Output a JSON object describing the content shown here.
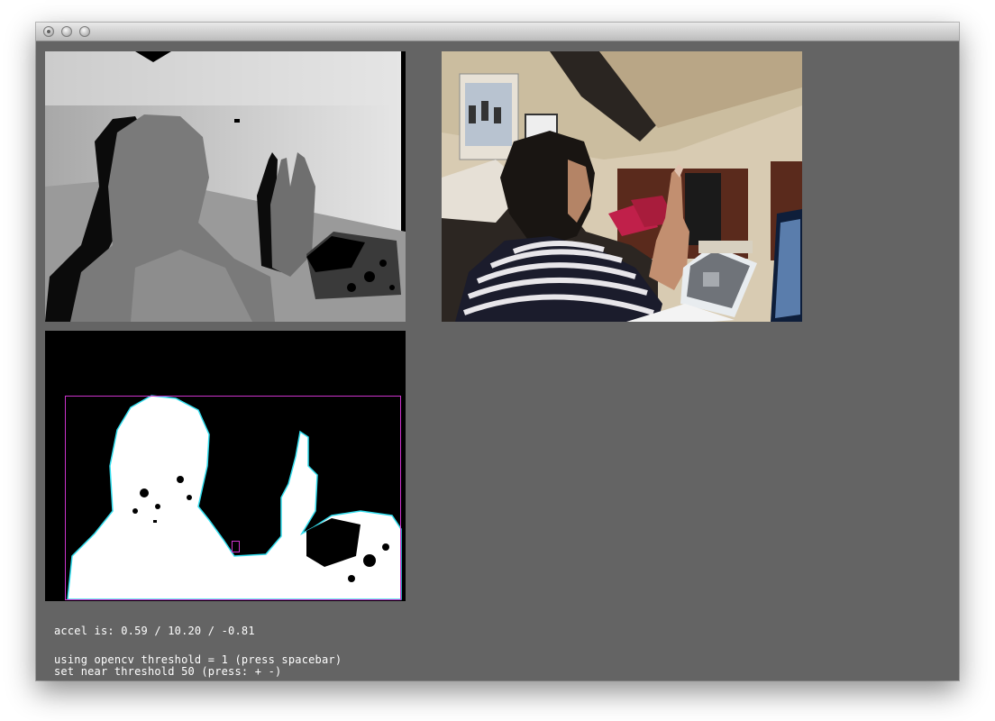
{
  "window": {
    "controls": [
      "close-icon",
      "minimize-icon",
      "zoom-icon"
    ]
  },
  "views": [
    {
      "name": "depth-image",
      "kind": "kinect depth map (grayscale)"
    },
    {
      "name": "rgb-camera-image",
      "kind": "color camera feed"
    },
    {
      "name": "threshold-image",
      "kind": "thresholded depth with contour bounding boxes",
      "bbox_color": "#cc33cc",
      "contour_color": "#33ddee"
    }
  ],
  "status": {
    "accel": "accel is: 0.59 / 10.20 / -0.81",
    "opencv": "using opencv threshold = 1 (press spacebar)",
    "near": "set near threshold 50 (press: + -)"
  },
  "colors": {
    "background": "#646464",
    "text": "#ffffff",
    "bbox": "#cc33cc"
  }
}
